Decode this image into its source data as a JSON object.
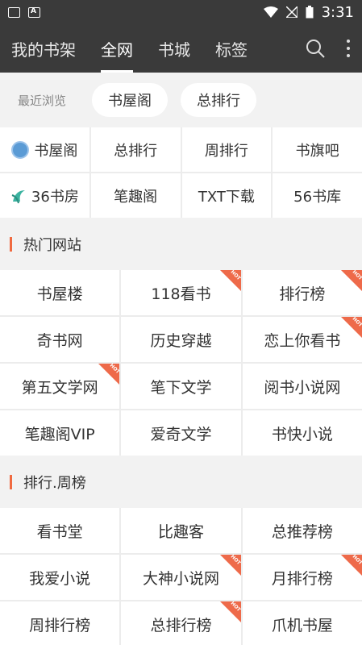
{
  "status": {
    "time": "3:31"
  },
  "nav": {
    "tabs": [
      {
        "label": "我的书架"
      },
      {
        "label": "全网"
      },
      {
        "label": "书城"
      },
      {
        "label": "标签"
      }
    ]
  },
  "recent": {
    "label": "最近浏览",
    "items": [
      "书屋阁",
      "总排行"
    ]
  },
  "quick": {
    "row1": [
      "书屋阁",
      "总排行",
      "周排行",
      "书旗吧"
    ],
    "row2": [
      "36书房",
      "笔趣阁",
      "TXT下载",
      "56书库"
    ]
  },
  "hot_sites": {
    "title": "热门网站",
    "items": [
      {
        "label": "书屋楼",
        "hot": false
      },
      {
        "label": "118看书",
        "hot": true
      },
      {
        "label": "排行榜",
        "hot": true
      },
      {
        "label": "奇书网",
        "hot": false
      },
      {
        "label": "历史穿越",
        "hot": false
      },
      {
        "label": "恋上你看书",
        "hot": true
      },
      {
        "label": "第五文学网",
        "hot": true
      },
      {
        "label": "笔下文学",
        "hot": false
      },
      {
        "label": "阅书小说网",
        "hot": false
      },
      {
        "label": "笔趣阁VIP",
        "hot": false
      },
      {
        "label": "爱奇文学",
        "hot": false
      },
      {
        "label": "书快小说",
        "hot": false
      }
    ]
  },
  "weekly": {
    "title": "排行.周榜",
    "items": [
      {
        "label": "看书堂",
        "hot": false
      },
      {
        "label": "比趣客",
        "hot": false
      },
      {
        "label": "总推荐榜",
        "hot": false
      },
      {
        "label": "我爱小说",
        "hot": false
      },
      {
        "label": "大神小说网",
        "hot": true
      },
      {
        "label": "月排行榜",
        "hot": true
      },
      {
        "label": "周排行榜",
        "hot": false
      },
      {
        "label": "总排行榜",
        "hot": true
      },
      {
        "label": "爪机书屋",
        "hot": false
      }
    ]
  },
  "hot_badge": "HOT"
}
